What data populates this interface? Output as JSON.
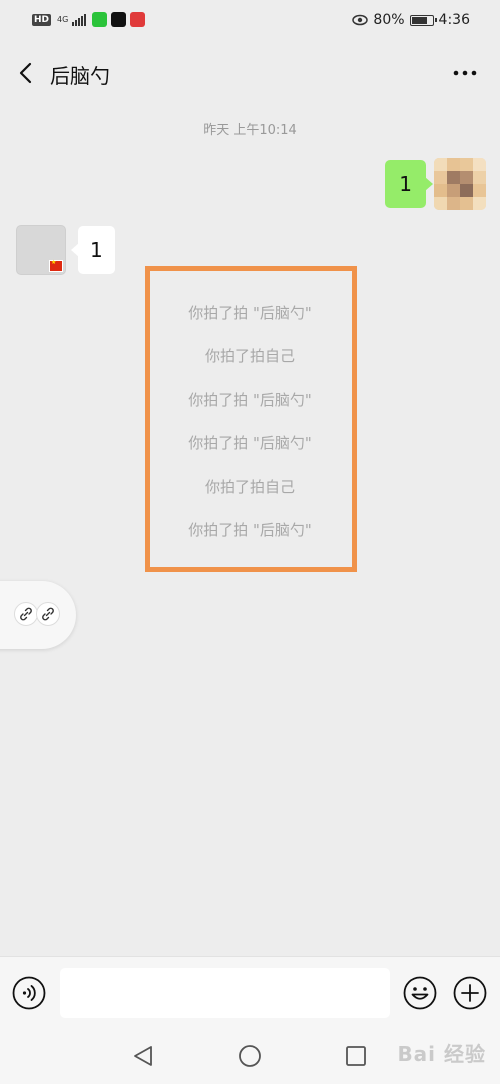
{
  "status_bar": {
    "hd_label": "HD",
    "network_label": "4G",
    "battery_percent": "80%",
    "battery_level": 0.8,
    "time": "4:36",
    "icons": [
      "hd-icon",
      "signal-icon",
      "iqiyi-app-icon",
      "douyin-app-icon",
      "game-app-icon",
      "eye-comfort-icon",
      "battery-icon"
    ]
  },
  "header": {
    "title": "后脑勺",
    "back_icon": "chevron-left-icon",
    "more_icon": "more-dots-icon"
  },
  "chat": {
    "timestamp": "昨天 上午10:14",
    "messages": [
      {
        "from": "self",
        "text": "1"
      },
      {
        "from": "other",
        "text": "1"
      }
    ],
    "pat_lines": [
      "你拍了拍 \"后脑勺\"",
      "你拍了拍自己",
      "你拍了拍 \"后脑勺\"",
      "你拍了拍 \"后脑勺\"",
      "你拍了拍自己",
      "你拍了拍 \"后脑勺\""
    ]
  },
  "colors": {
    "background": "#ededed",
    "self_bubble": "#95ec69",
    "other_bubble": "#ffffff",
    "highlight_border": "#f0924a",
    "pat_text": "#a8a8a8"
  },
  "floating_bar": {
    "icons": [
      "link-icon",
      "link-icon"
    ]
  },
  "input_bar": {
    "icons": [
      "voice-icon",
      "emoji-icon",
      "plus-icon"
    ],
    "placeholder": ""
  },
  "nav_bar": {
    "icons": [
      "nav-back-icon",
      "nav-home-icon",
      "nav-recents-icon"
    ],
    "watermark": "Bai 经验"
  }
}
